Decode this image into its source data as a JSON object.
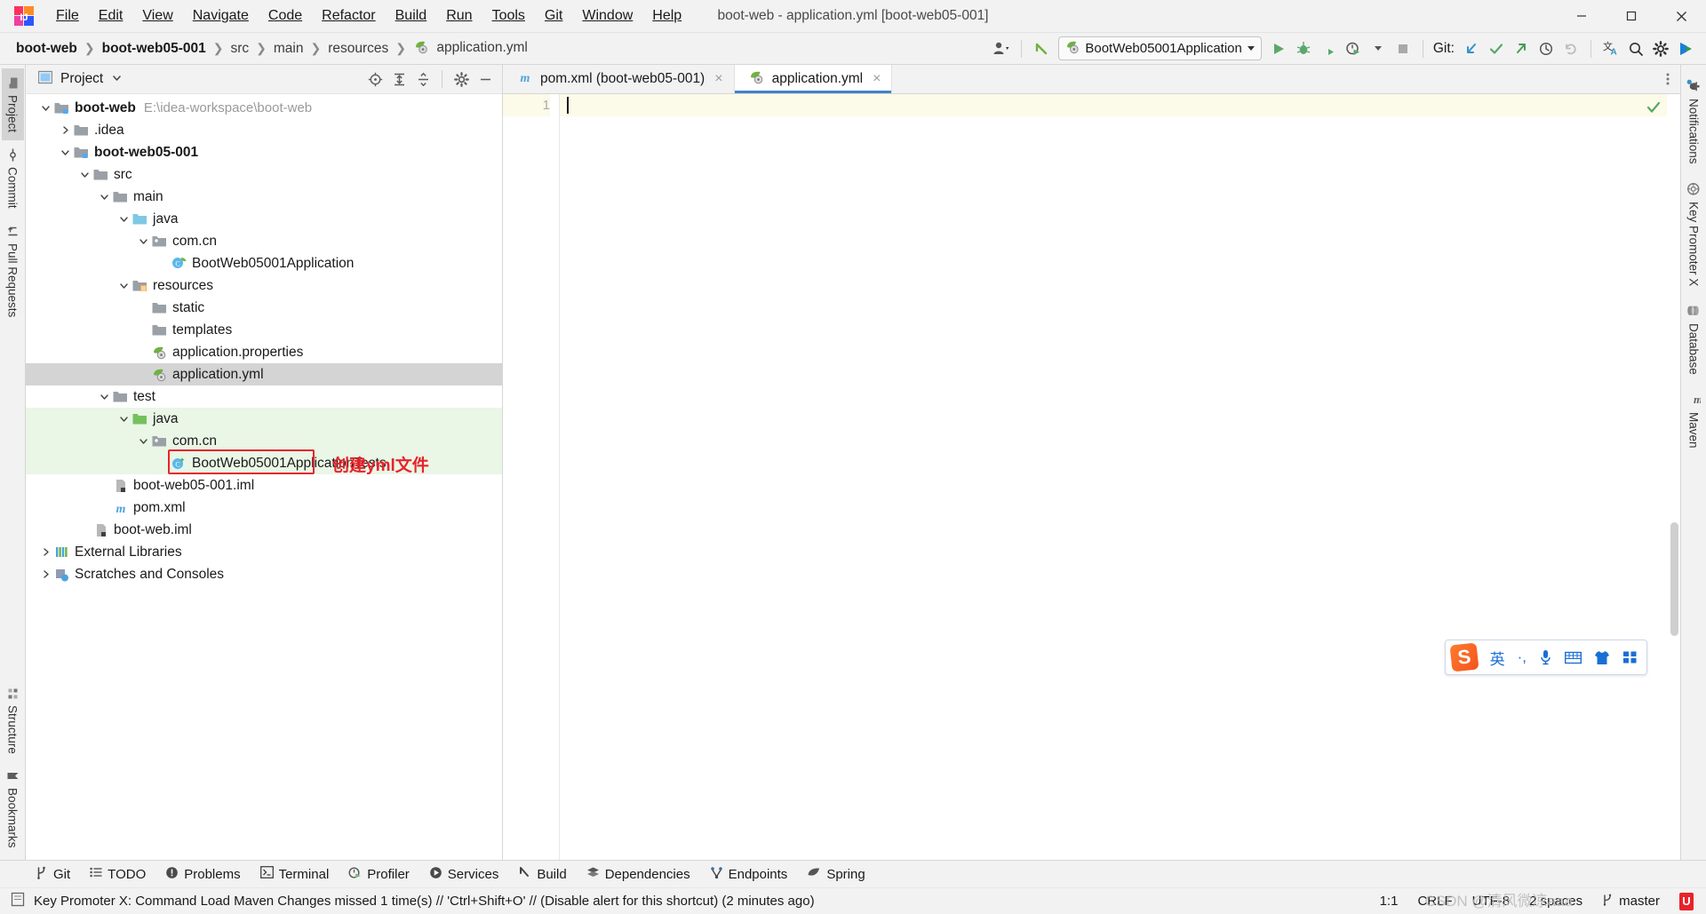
{
  "window": {
    "title": "boot-web - application.yml [boot-web05-001]",
    "logo_name": "intellij-idea-logo",
    "minimize_label": "Minimize",
    "maximize_label": "Maximize",
    "close_label": "Close"
  },
  "menubar": [
    {
      "label": "File",
      "mnemonic": "F"
    },
    {
      "label": "Edit",
      "mnemonic": "E"
    },
    {
      "label": "View",
      "mnemonic": "V"
    },
    {
      "label": "Navigate",
      "mnemonic": "N"
    },
    {
      "label": "Code",
      "mnemonic": "C"
    },
    {
      "label": "Refactor",
      "mnemonic": "R"
    },
    {
      "label": "Build",
      "mnemonic": "B"
    },
    {
      "label": "Run",
      "mnemonic": "R"
    },
    {
      "label": "Tools",
      "mnemonic": "T"
    },
    {
      "label": "Git",
      "mnemonic": "G"
    },
    {
      "label": "Window",
      "mnemonic": "W"
    },
    {
      "label": "Help",
      "mnemonic": "H"
    }
  ],
  "breadcrumbs": [
    {
      "label": "boot-web",
      "bold": true,
      "icon": ""
    },
    {
      "label": "boot-web05-001",
      "bold": true,
      "icon": ""
    },
    {
      "label": "src",
      "bold": false,
      "icon": ""
    },
    {
      "label": "main",
      "bold": false,
      "icon": ""
    },
    {
      "label": "resources",
      "bold": false,
      "icon": ""
    },
    {
      "label": "application.yml",
      "bold": false,
      "icon": "spring-yml-icon"
    }
  ],
  "toolbar": {
    "account_icon": "user-account-icon",
    "back_icon": "back-arrow-icon",
    "run_configuration": "BootWeb05001Application",
    "run_config_icon": "spring-boot-icon",
    "run_icon": "run-icon",
    "debug_icon": "debug-icon",
    "run_with_coverage_icon": "run-with-coverage-icon",
    "profile_icon": "profiler-icon",
    "stop_icon": "stop-icon",
    "git_label": "Git:",
    "git_update_icon": "git-update-project-icon",
    "git_commit_icon": "git-commit-icon",
    "git_push_icon": "git-push-icon",
    "git_history_icon": "git-history-icon",
    "git_rollback_icon": "git-rollback-icon",
    "translate_icon": "translate-icon",
    "search_icon": "search-everywhere-icon",
    "settings_icon": "settings-gear-icon",
    "ide_features_icon": "ide-features-trainer-icon"
  },
  "left_rail": {
    "top": [
      {
        "label": "Project",
        "icon": "project-folder-icon",
        "active": true
      },
      {
        "label": "Commit",
        "icon": "commit-icon",
        "active": false
      },
      {
        "label": "Pull Requests",
        "icon": "pull-request-icon",
        "active": false
      }
    ],
    "bottom": [
      {
        "label": "Structure",
        "icon": "structure-icon",
        "active": false
      },
      {
        "label": "Bookmarks",
        "icon": "bookmark-icon",
        "active": false
      }
    ]
  },
  "right_rail": [
    {
      "label": "Notifications",
      "icon": "notifications-bell-icon",
      "badge": true
    },
    {
      "label": "Key Promoter X",
      "icon": "key-promoter-icon",
      "badge": false
    },
    {
      "label": "Database",
      "icon": "database-icon",
      "badge": false
    },
    {
      "label": "Maven",
      "icon": "maven-icon",
      "badge": false
    }
  ],
  "project_panel": {
    "title": "Project",
    "caret_icon": "chevron-down-icon",
    "tools": [
      {
        "name": "scroll-from-source-icon",
        "label": "Select Opened File"
      },
      {
        "name": "expand-all-icon",
        "label": "Expand All"
      },
      {
        "name": "collapse-all-icon",
        "label": "Collapse All"
      },
      {
        "name": "settings-gear-icon",
        "label": "Options"
      },
      {
        "name": "hide-icon",
        "label": "Hide"
      }
    ],
    "tree": [
      {
        "label": "boot-web",
        "path": "E:\\idea-workspace\\boot-web",
        "depth": 0,
        "arrow": "down",
        "icon": "module-folder-icon",
        "bold": true,
        "state": "normal"
      },
      {
        "label": ".idea",
        "path": "",
        "depth": 1,
        "arrow": "right",
        "icon": "folder-icon",
        "bold": false,
        "state": "normal"
      },
      {
        "label": "boot-web05-001",
        "path": "",
        "depth": 1,
        "arrow": "down",
        "icon": "module-folder-icon",
        "bold": true,
        "state": "normal"
      },
      {
        "label": "src",
        "path": "",
        "depth": 2,
        "arrow": "down",
        "icon": "folder-icon",
        "bold": false,
        "state": "normal"
      },
      {
        "label": "main",
        "path": "",
        "depth": 3,
        "arrow": "down",
        "icon": "folder-icon",
        "bold": false,
        "state": "normal"
      },
      {
        "label": "java",
        "path": "",
        "depth": 4,
        "arrow": "down",
        "icon": "source-root-icon",
        "bold": false,
        "state": "normal"
      },
      {
        "label": "com.cn",
        "path": "",
        "depth": 5,
        "arrow": "down",
        "icon": "package-icon",
        "bold": false,
        "state": "normal"
      },
      {
        "label": "BootWeb05001Application",
        "path": "",
        "depth": 6,
        "arrow": "none",
        "icon": "spring-class-icon",
        "bold": false,
        "state": "normal"
      },
      {
        "label": "resources",
        "path": "",
        "depth": 4,
        "arrow": "down",
        "icon": "resource-root-icon",
        "bold": false,
        "state": "normal"
      },
      {
        "label": "static",
        "path": "",
        "depth": 5,
        "arrow": "none",
        "icon": "folder-icon",
        "bold": false,
        "state": "normal"
      },
      {
        "label": "templates",
        "path": "",
        "depth": 5,
        "arrow": "none",
        "icon": "folder-icon",
        "bold": false,
        "state": "normal"
      },
      {
        "label": "application.properties",
        "path": "",
        "depth": 5,
        "arrow": "none",
        "icon": "spring-properties-icon",
        "bold": false,
        "state": "normal"
      },
      {
        "label": "application.yml",
        "path": "",
        "depth": 5,
        "arrow": "none",
        "icon": "spring-yml-icon",
        "bold": false,
        "state": "selected"
      },
      {
        "label": "test",
        "path": "",
        "depth": 3,
        "arrow": "down",
        "icon": "folder-icon",
        "bold": false,
        "state": "normal"
      },
      {
        "label": "java",
        "path": "",
        "depth": 4,
        "arrow": "down",
        "icon": "test-source-root-icon",
        "bold": false,
        "state": "green"
      },
      {
        "label": "com.cn",
        "path": "",
        "depth": 5,
        "arrow": "down",
        "icon": "package-icon",
        "bold": false,
        "state": "green"
      },
      {
        "label": "BootWeb05001ApplicationTests",
        "path": "",
        "depth": 6,
        "arrow": "none",
        "icon": "test-class-icon",
        "bold": false,
        "state": "green"
      },
      {
        "label": "boot-web05-001.iml",
        "path": "",
        "depth": 2,
        "arrow": "none",
        "icon": "iml-file-icon",
        "bold": false,
        "state": "normal"
      },
      {
        "label": "pom.xml",
        "path": "",
        "depth": 2,
        "arrow": "none",
        "icon": "maven-pom-icon",
        "bold": false,
        "state": "normal"
      },
      {
        "label": "boot-web.iml",
        "path": "",
        "depth": 1,
        "arrow": "none",
        "icon": "iml-file-icon",
        "bold": false,
        "state": "normal"
      },
      {
        "label": "External Libraries",
        "path": "",
        "depth": 0,
        "arrow": "right",
        "icon": "external-libraries-icon",
        "bold": false,
        "state": "normal"
      },
      {
        "label": "Scratches and Consoles",
        "path": "",
        "depth": 0,
        "arrow": "right",
        "icon": "scratches-icon",
        "bold": false,
        "state": "normal"
      }
    ],
    "annotation": {
      "text": "创建yml文件",
      "color": "#e8232a"
    }
  },
  "editor": {
    "tabs": [
      {
        "label": "pom.xml (boot-web05-001)",
        "icon": "maven-pom-icon",
        "active": false,
        "close": "×"
      },
      {
        "label": "application.yml",
        "icon": "spring-yml-icon",
        "active": true,
        "close": "×"
      }
    ],
    "more_icon": "more-vertical-icon",
    "line_numbers": [
      "1"
    ],
    "content": "",
    "inspection_icon": "inspection-ok-icon"
  },
  "sogou_ime": {
    "logo": "S",
    "mode": "英",
    "punctuation": "·,",
    "mic_icon": "microphone-icon",
    "keyboard_icon": "soft-keyboard-icon",
    "skin_icon": "skin-shirt-icon",
    "apps_icon": "toolbox-apps-icon"
  },
  "tool_windows": [
    {
      "label": "Git",
      "icon": "git-branch-icon"
    },
    {
      "label": "TODO",
      "icon": "todo-list-icon"
    },
    {
      "label": "Problems",
      "icon": "problems-icon"
    },
    {
      "label": "Terminal",
      "icon": "terminal-icon"
    },
    {
      "label": "Profiler",
      "icon": "profiler-icon"
    },
    {
      "label": "Services",
      "icon": "services-icon"
    },
    {
      "label": "Build",
      "icon": "build-hammer-icon"
    },
    {
      "label": "Dependencies",
      "icon": "dependencies-icon"
    },
    {
      "label": "Endpoints",
      "icon": "endpoints-icon"
    },
    {
      "label": "Spring",
      "icon": "spring-leaf-icon"
    }
  ],
  "statusbar": {
    "message_icon": "event-log-icon",
    "message": "Key Promoter X: Command Load Maven Changes missed 1 time(s) // 'Ctrl+Shift+O' // (Disable alert for this shortcut) (2 minutes ago)",
    "caret_position": "1:1",
    "line_separator": "CRLF",
    "encoding": "UTF-8",
    "indent": "2 spaces",
    "branch": "master",
    "branch_icon": "git-branch-icon",
    "watermark": "CSDN @清风微凉aaa",
    "ime_indicator": "ime-icon"
  },
  "colors": {
    "accent_blue": "#4183c4",
    "annotation_red": "#e8232a",
    "spring_green": "#6db33f",
    "selection_gray": "#d4d4d4",
    "test_green_bg": "#eaf6e6",
    "current_line": "#fcfae8"
  }
}
